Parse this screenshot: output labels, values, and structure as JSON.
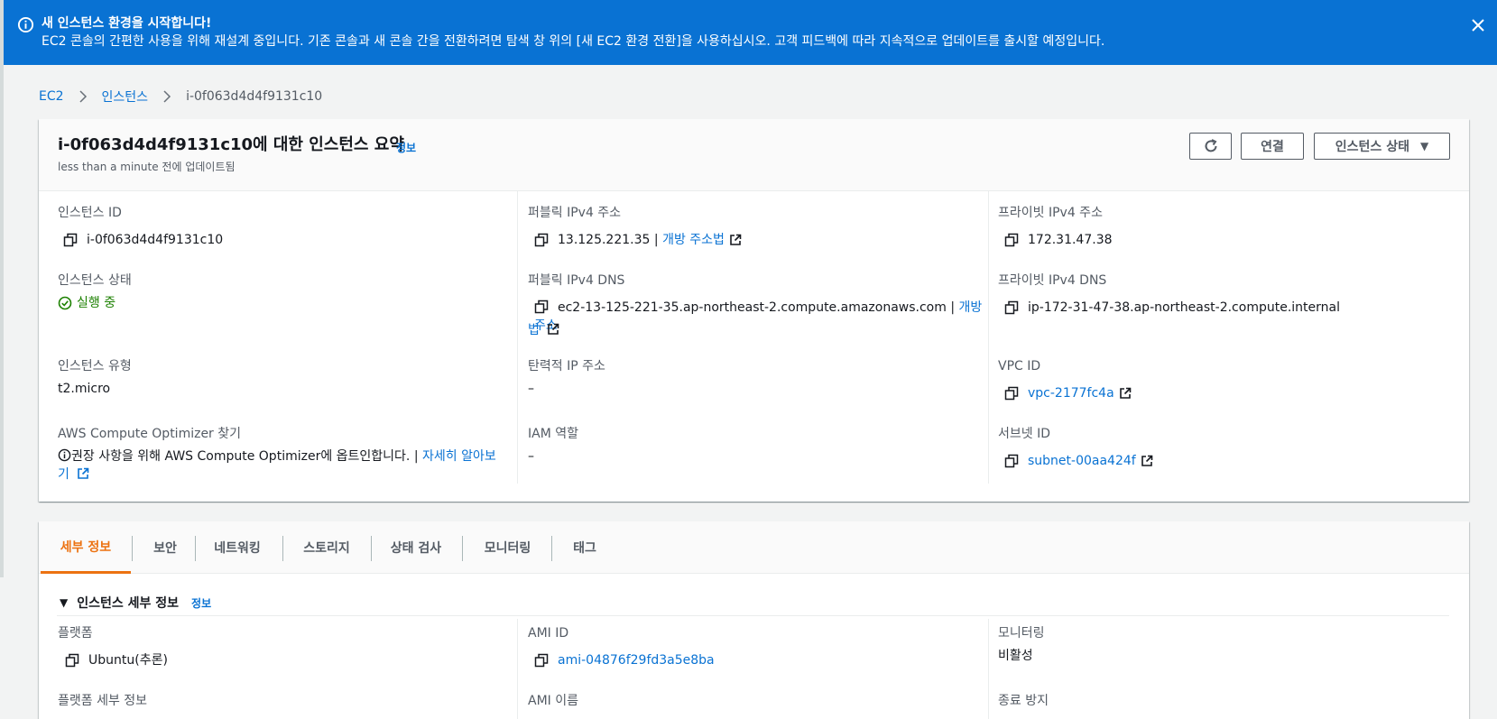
{
  "banner": {
    "title": "새 인스턴스 환경을 시작합니다!",
    "message": "EC2 콘솔의 간편한 사용을 위해 재설계 중입니다. 기존 콘솔과 새 콘솔 간을 전환하려면 탐색 창 위의 [새 EC2 환경 전환]을 사용하십시오. 고객 피드백에 따라 지속적으로 업데이트를 출시할 예정입니다."
  },
  "breadcrumb": {
    "items": [
      "EC2",
      "인스턴스"
    ],
    "current": "i-0f063d4d4f9131c10"
  },
  "summary": {
    "title": "i-0f063d4d4f9131c10에 대한 인스턴스 요약",
    "info_link": "정보",
    "updated_prefix": "less than a minute",
    "updated_suffix": " 전에 업데이트됨",
    "connect_label": "연결",
    "state_menu_label": "인스턴스 상태",
    "instance_id_label": "인스턴스 ID",
    "instance_id": "i-0f063d4d4f9131c10",
    "public_ipv4_label": "퍼블릭 IPv4 주소",
    "public_ipv4": "13.125.221.35",
    "public_ipv4_sep": " | ",
    "open_address": "개방 주소법",
    "private_ipv4_label": "프라이빗 IPv4 주소",
    "private_ipv4": "172.31.47.38",
    "state_label": "인스턴스 상태",
    "state": "실행 중",
    "public_dns_label": "퍼블릭 IPv4 DNS",
    "public_dns": "ec2-13-125-221-35.ap-northeast-2.compute.amazonaws.com",
    "public_dns_sep": " | ",
    "open_address_dns_1": "개방 주소",
    "open_address_dns_2": "법",
    "private_dns_label": "프라이빗 IPv4 DNS",
    "private_dns": "ip-172-31-47-38.ap-northeast-2.compute.internal",
    "type_label": "인스턴스 유형",
    "type": "t2.micro",
    "elastic_ip_label": "탄력적 IP 주소",
    "elastic_ip": "–",
    "vpc_label": "VPC ID",
    "vpc": "vpc-2177fc4a",
    "optimizer_label": "AWS Compute Optimizer 찾기",
    "optimizer_text": "권장 사항을 위해 AWS Compute Optimizer에 옵트인합니다. | ",
    "optimizer_link_1": "자세히 알아보",
    "optimizer_link_2": "기",
    "iam_label": "IAM 역할",
    "iam": "–",
    "subnet_label": "서브넷 ID",
    "subnet": "subnet-00aa424f"
  },
  "tabs": [
    "세부 정보",
    "보안",
    "네트워킹",
    "스토리지",
    "상태 검사",
    "모니터링",
    "태그"
  ],
  "details": {
    "section_title": "인스턴스 세부 정보",
    "info_link": "정보",
    "platform_label": "플랫폼",
    "platform": "Ubuntu(추론)",
    "ami_id_label": "AMI ID",
    "ami_id": "ami-04876f29fd3a5e8ba",
    "monitoring_label": "모니터링",
    "monitoring": "비활성",
    "platform_detail_label": "플랫폼 세부 정보",
    "ami_name_label": "AMI 이름",
    "termination_label": "종료 방지"
  },
  "colors": {
    "banner": "#0972d3",
    "link": "#0972d3",
    "active_tab": "#ec7211",
    "running": "#1d8102"
  }
}
